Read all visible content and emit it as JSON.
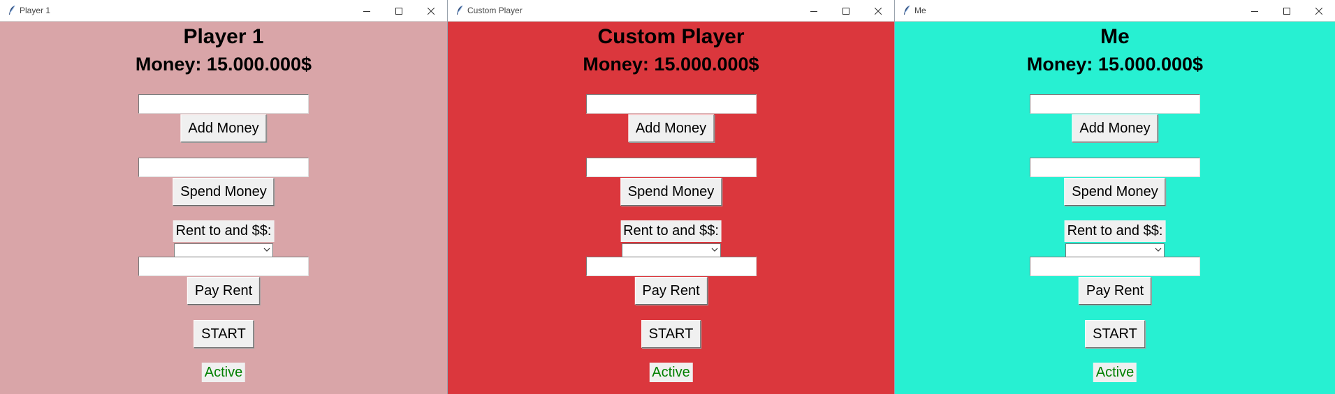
{
  "windows": [
    {
      "title": "Player 1",
      "background": "#d9a5a8",
      "player_name": "Player 1",
      "money": "Money: 15.000.000$",
      "add_money_label": "Add Money",
      "spend_money_label": "Spend Money",
      "rent_label": "Rent to and $$:",
      "rent_target_selected": "",
      "pay_rent_label": "Pay Rent",
      "start_label": "START",
      "status": "Active",
      "status_color": "#008000"
    },
    {
      "title": "Custom Player",
      "background": "#db373d",
      "player_name": "Custom Player",
      "money": "Money: 15.000.000$",
      "add_money_label": "Add Money",
      "spend_money_label": "Spend Money",
      "rent_label": "Rent to and $$:",
      "rent_target_selected": "",
      "pay_rent_label": "Pay Rent",
      "start_label": "START",
      "status": "Active",
      "status_color": "#008000"
    },
    {
      "title": "Me",
      "background": "#27f0d2",
      "player_name": "Me",
      "money": "Money: 15.000.000$",
      "add_money_label": "Add Money",
      "spend_money_label": "Spend Money",
      "rent_label": "Rent to and $$:",
      "rent_target_selected": "",
      "pay_rent_label": "Pay Rent",
      "start_label": "START",
      "status": "Active",
      "status_color": "#008000"
    }
  ],
  "icons": {
    "app": "feather-icon",
    "minimize": "minimize-icon",
    "maximize": "maximize-icon",
    "close": "close-icon",
    "dropdown": "chevron-down-icon"
  }
}
